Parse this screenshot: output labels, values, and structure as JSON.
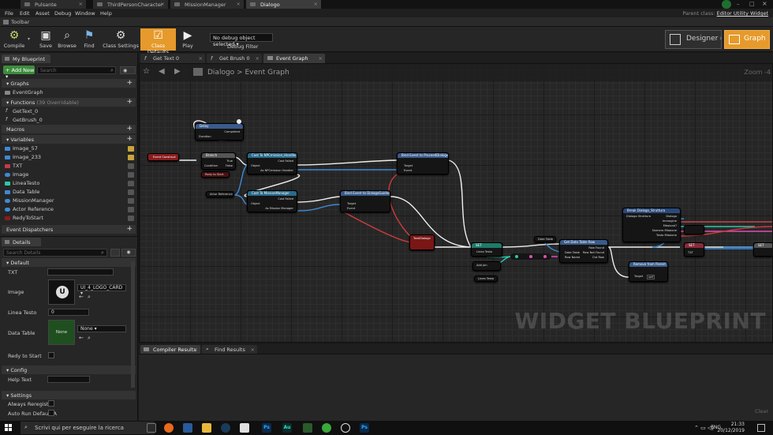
{
  "doc_tabs": [
    {
      "label": "Pulsante",
      "active": false
    },
    {
      "label": "ThirdPersonCharacter",
      "active": false
    },
    {
      "label": "MissionManager",
      "active": false
    },
    {
      "label": "Dialogo",
      "active": true
    }
  ],
  "menu": [
    "File",
    "Edit",
    "Asset",
    "Debug",
    "Window",
    "Help"
  ],
  "parent_class": {
    "label": "Parent class:",
    "value": "Editor Utility Widget"
  },
  "toolbar_label": "Toolbar",
  "toolbar": {
    "compile": "Compile",
    "save": "Save",
    "browse": "Browse",
    "find": "Find",
    "class_settings": "Class Settings",
    "class_defaults": "Class Defaults",
    "play": "Play",
    "debug_select": "No debug object selected",
    "debug_filter": "Debug Filter"
  },
  "mode": {
    "designer": "Designer",
    "graph": "Graph"
  },
  "my_blueprint": {
    "tab": "My Blueprint",
    "add_new": "Add New",
    "search_placeholder": "Search",
    "graphs_head": "Graphs",
    "event_graph": "EventGraph",
    "functions_head": "Functions",
    "functions_count": "(39 Overridable)",
    "functions": [
      "GetText_0",
      "GetBrush_0"
    ],
    "macros_head": "Macros",
    "variables_head": "Variables",
    "variables": [
      {
        "name": "Image_57",
        "color": "#3d8ad6"
      },
      {
        "name": "Image_233",
        "color": "#3d8ad6"
      },
      {
        "name": "TXT",
        "color": "#c43a4b"
      },
      {
        "name": "Image",
        "color": "#3d8ad6"
      },
      {
        "name": "LineaTesto",
        "color": "#2ec8a8"
      },
      {
        "name": "Data Table",
        "color": "#3d8ad6"
      },
      {
        "name": "MissionManager",
        "color": "#3d8ad6"
      },
      {
        "name": "Actor Reference",
        "color": "#3d8ad6"
      },
      {
        "name": "RedyToStart",
        "color": "#8a1c1c"
      }
    ],
    "event_dispatchers_head": "Event Dispatchers"
  },
  "details": {
    "tab": "Details",
    "search_placeholder": "Search Details",
    "default_head": "Default",
    "txt_label": "TXT",
    "image_label": "Image",
    "image_value": "UI_4_LOGO_CARD",
    "linea_label": "Linea Testo",
    "linea_value": "0",
    "datatable_label": "Data Table",
    "datatable_value": "None",
    "datatable_thumb": "None",
    "ready_label": "Redy to Start",
    "config_head": "Config",
    "helptext_label": "Help Text",
    "settings_head": "Settings",
    "always_reregister": "Always Reregister",
    "auto_run": "Auto Run Default A"
  },
  "graph_tabs": [
    {
      "label": "Get Text 0",
      "active": false
    },
    {
      "label": "Get Brush 0",
      "active": false
    },
    {
      "label": "Event Graph",
      "active": true
    }
  ],
  "graph": {
    "breadcrumb_root": "Dialogo",
    "breadcrumb_sep": ">",
    "breadcrumb_leaf": "Event Graph",
    "zoom": "Zoom -4",
    "watermark": "WIDGET BLUEPRINT"
  },
  "nodes": {
    "delay": "Delay",
    "delay_completed": "Completed",
    "delay_duration": "Duration",
    "event_construct": "Event Construct",
    "branch": "Branch",
    "branch_true": "True",
    "branch_false": "False",
    "branch_condition": "Condition",
    "redy_to_start": "Redy to Start",
    "cast_npc": "Cast To NPCmission_Handler",
    "cast_npc_object": "Object",
    "cast_npc_failed": "Cast Failed",
    "cast_npc_as": "As NPCmission Handler",
    "actor_reference": "Actor Reference",
    "cast_mm": "Cast To MissionManager",
    "cast_mm_object": "Object",
    "cast_mm_failed": "Cast Failed",
    "cast_mm_as": "As Mission Manager",
    "bind_proceed": "Bind Event to ProceedDialoge",
    "bind_proceed_target": "Target",
    "bind_proceed_event": "Event",
    "bind_guide": "Bind Event to DialogoGuidedentro",
    "bind_guide_target": "Target",
    "bind_guide_event": "Event",
    "text_dialogo": "TestiDialogo",
    "set": "SET",
    "linea_testo": "Linea Testo",
    "add_pin": "Add pin",
    "get_data_table_row": "Get Data Table Row",
    "data_table": "Data Table",
    "row_name": "Row Name",
    "row_found": "Row Found",
    "row_not_found": "Row Not Found",
    "out_row": "Out Row",
    "break_struct": "Break Dialogo_Struttura",
    "break_struct_pin": "Dialogo Struttura",
    "break_dialogo": "Dialogo",
    "break_immagine": "Immagine",
    "break_missione": "Missione?",
    "break_numero": "Numero Missione",
    "break_testo": "Testo Missione",
    "remove_parent": "Remove from Parent",
    "remove_target": "Target",
    "remove_self": "self",
    "txt": "TXT",
    "set2": "SET"
  },
  "bottom_tabs": [
    "Compiler Results",
    "Find Results"
  ],
  "clear": "Clear",
  "taskbar": {
    "search": "Scrivi qui per eseguire la ricerca",
    "lang": "ENG",
    "time": "21:33",
    "date": "20/12/2019",
    "ps1": "Ps",
    "ps2": "Ps",
    "au": "Au"
  }
}
